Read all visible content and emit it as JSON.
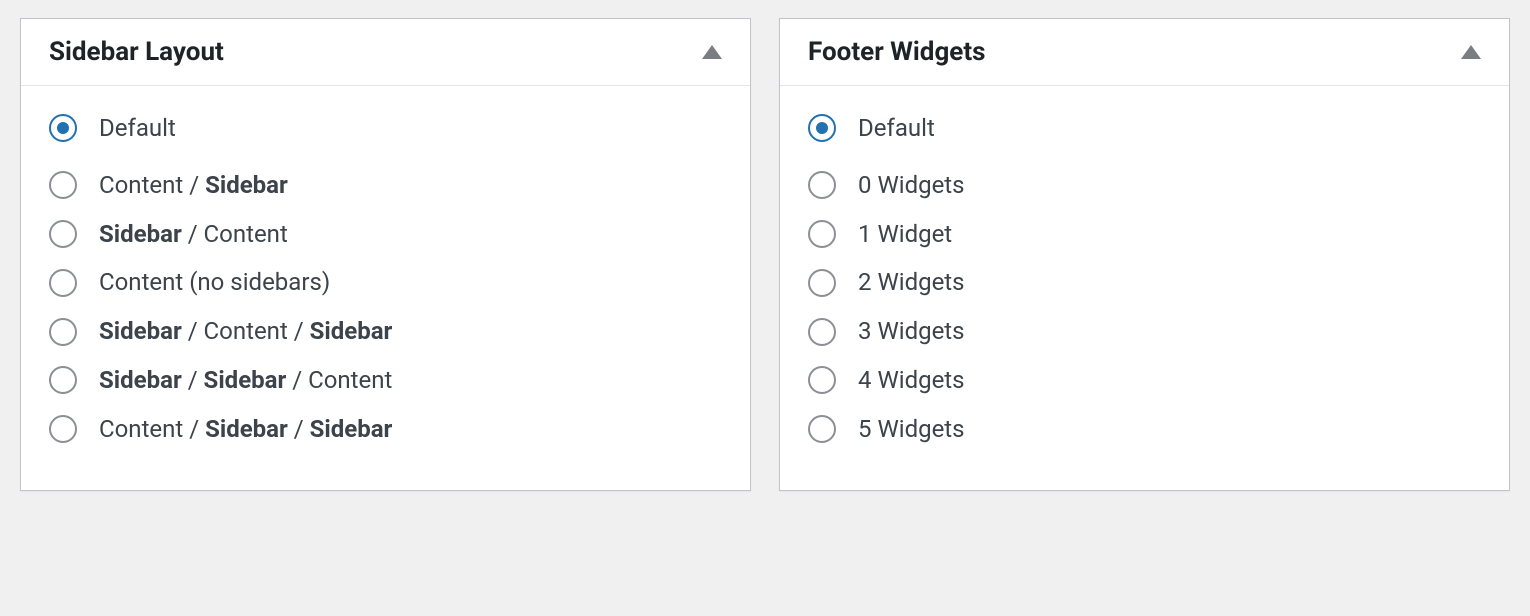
{
  "sidebar_layout": {
    "title": "Sidebar Layout",
    "options": [
      {
        "segments": [
          {
            "text": "Default",
            "bold": false
          }
        ],
        "checked": true
      },
      {
        "segments": [
          {
            "text": "Content / ",
            "bold": false
          },
          {
            "text": "Sidebar",
            "bold": true
          }
        ],
        "checked": false
      },
      {
        "segments": [
          {
            "text": "Sidebar",
            "bold": true
          },
          {
            "text": " / Content",
            "bold": false
          }
        ],
        "checked": false
      },
      {
        "segments": [
          {
            "text": "Content (no sidebars)",
            "bold": false
          }
        ],
        "checked": false
      },
      {
        "segments": [
          {
            "text": "Sidebar",
            "bold": true
          },
          {
            "text": " / Content / ",
            "bold": false
          },
          {
            "text": "Sidebar",
            "bold": true
          }
        ],
        "checked": false
      },
      {
        "segments": [
          {
            "text": "Sidebar",
            "bold": true
          },
          {
            "text": " / ",
            "bold": false
          },
          {
            "text": "Sidebar",
            "bold": true
          },
          {
            "text": " / Content",
            "bold": false
          }
        ],
        "checked": false
      },
      {
        "segments": [
          {
            "text": "Content / ",
            "bold": false
          },
          {
            "text": "Sidebar",
            "bold": true
          },
          {
            "text": " / ",
            "bold": false
          },
          {
            "text": "Sidebar",
            "bold": true
          }
        ],
        "checked": false
      }
    ]
  },
  "footer_widgets": {
    "title": "Footer Widgets",
    "options": [
      {
        "segments": [
          {
            "text": "Default",
            "bold": false
          }
        ],
        "checked": true
      },
      {
        "segments": [
          {
            "text": "0 Widgets",
            "bold": false
          }
        ],
        "checked": false
      },
      {
        "segments": [
          {
            "text": "1 Widget",
            "bold": false
          }
        ],
        "checked": false
      },
      {
        "segments": [
          {
            "text": "2 Widgets",
            "bold": false
          }
        ],
        "checked": false
      },
      {
        "segments": [
          {
            "text": "3 Widgets",
            "bold": false
          }
        ],
        "checked": false
      },
      {
        "segments": [
          {
            "text": "4 Widgets",
            "bold": false
          }
        ],
        "checked": false
      },
      {
        "segments": [
          {
            "text": "5 Widgets",
            "bold": false
          }
        ],
        "checked": false
      }
    ]
  }
}
